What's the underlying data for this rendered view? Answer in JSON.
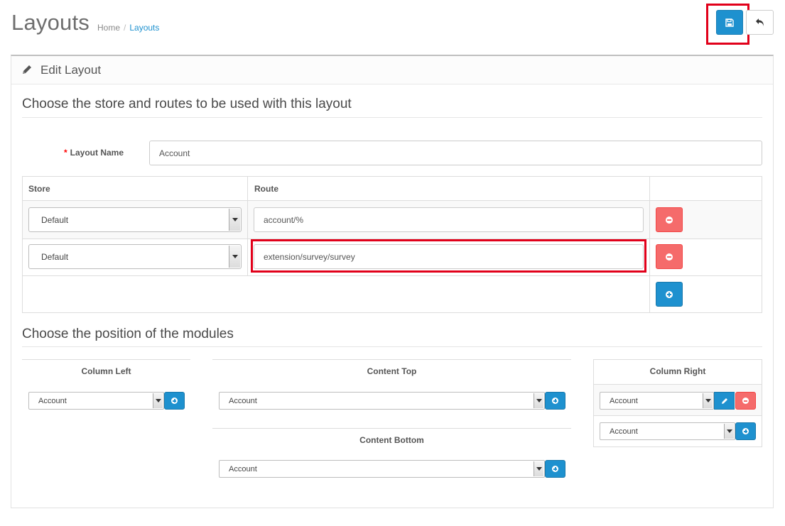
{
  "header": {
    "title": "Layouts",
    "breadcrumb": [
      "Home",
      "Layouts"
    ]
  },
  "toolbar": {
    "save_icon": "floppy-disk-icon",
    "back_icon": "reply-arrow-icon"
  },
  "panel": {
    "title": "Edit Layout",
    "title_icon": "pencil-icon"
  },
  "routes_section": {
    "legend": "Choose the store and routes to be used with this layout",
    "layout_name_label": "Layout Name",
    "layout_name_value": "Account",
    "columns": [
      "Store",
      "Route"
    ],
    "rows": [
      {
        "store": "Default",
        "route": "account/%"
      },
      {
        "store": "Default",
        "route": "extension/survey/survey"
      }
    ]
  },
  "modules_section": {
    "legend": "Choose the position of the modules",
    "column_left": {
      "heading": "Column Left",
      "select": "Account"
    },
    "content_top": {
      "heading": "Content Top",
      "select": "Account"
    },
    "content_bottom": {
      "heading": "Content Bottom",
      "select": "Account"
    },
    "column_right": {
      "heading": "Column Right",
      "module": "Account",
      "select": "Account"
    }
  },
  "colors": {
    "primary": "#1e91cf",
    "danger": "#f56b6b",
    "highlight": "#e1001a"
  }
}
